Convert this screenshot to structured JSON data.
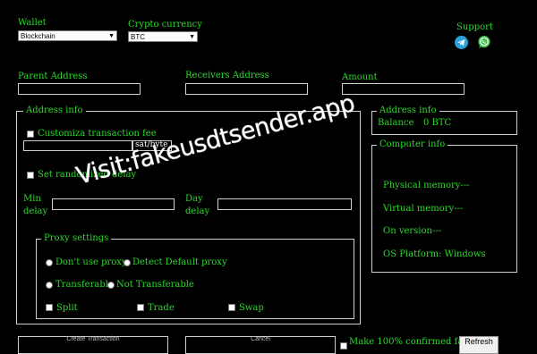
{
  "header": {
    "wallet_label": "Wallet",
    "wallet_value": "Blockchain",
    "crypto_label": "Crypto currency",
    "crypto_value": "BTC",
    "support_label": "Support"
  },
  "fields": {
    "parent_address_label": "Parent Address",
    "receivers_address_label": "Receivers Address",
    "amount_label": "Amount"
  },
  "address_panel": {
    "legend": "Address info",
    "customize_fee_label": "Customiza transaction fee",
    "fee_unit": "sat/byte",
    "randomized_delay_label": "Set randomized delay",
    "min_delay_label_1": "Min",
    "min_delay_label_2": "delay",
    "day_delay_label_1": "Day",
    "day_delay_label_2": "delay"
  },
  "proxy": {
    "legend": "Proxy settings",
    "opt_dont_use": "Don't use proxy",
    "opt_detect": "Detect Default proxy",
    "opt_transferable": "Transferable",
    "opt_not_transferable": "Not Transferable",
    "cb_split": "Split",
    "cb_trade": "Trade",
    "cb_swap": "Swap"
  },
  "address_info": {
    "legend": "Address info",
    "balance_label": "Balance",
    "balance_value": "0 BTC"
  },
  "computer_info": {
    "legend": "Computer info",
    "physical_memory": "Physical memory---",
    "virtual_memory": "Virtual memory---",
    "on_version": "On version---",
    "os_platform": "OS Platform: Windows"
  },
  "bottom": {
    "create_button": "Create Transaction",
    "cancel_button": "Cancel",
    "confirmed_label": "Make 100% confirmed fake",
    "refresh_button": "Refresh"
  },
  "watermark": "Visit:fakeusdtsender.app",
  "colors": {
    "background": "#000000",
    "text_green": "#2bd92b",
    "border": "#cfcfcf",
    "telegram": "#2aa3dd",
    "whatsapp": "#3fc24f"
  }
}
